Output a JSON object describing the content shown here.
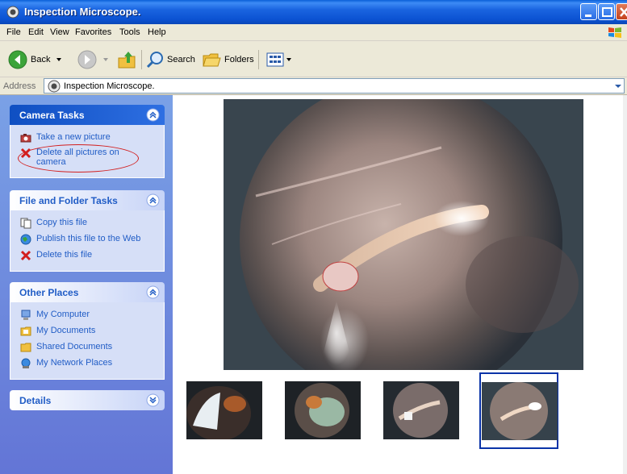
{
  "window": {
    "title": "Inspection Microscope."
  },
  "menu": [
    "File",
    "Edit",
    "View",
    "Favorites",
    "Tools",
    "Help"
  ],
  "toolbar": {
    "back_label": "Back",
    "search_label": "Search",
    "folders_label": "Folders"
  },
  "address": {
    "label": "Address",
    "value": "Inspection Microscope."
  },
  "panels": {
    "camera_tasks": {
      "title": "Camera Tasks",
      "items": [
        "Take a new picture",
        "Delete all pictures on camera"
      ]
    },
    "file_folder_tasks": {
      "title": "File and Folder Tasks",
      "items": [
        "Copy this file",
        "Publish this file to the Web",
        "Delete this file"
      ]
    },
    "other_places": {
      "title": "Other Places",
      "items": [
        "My Computer",
        "My Documents",
        "Shared Documents",
        "My Network Places"
      ]
    },
    "details": {
      "title": "Details"
    }
  },
  "thumbnails": {
    "count": 4,
    "selected_index": 3
  },
  "colors": {
    "titlebar": "#0b52d2",
    "task_pane": "#6f8ee0",
    "link": "#215dc6",
    "annotation": "#d21e1e",
    "selection": "#0a33a8"
  }
}
